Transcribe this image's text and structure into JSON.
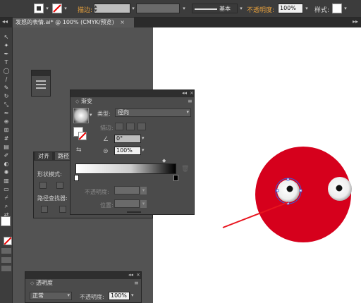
{
  "control_bar": {
    "stroke_label": "描边:",
    "stroke_profile": "基本",
    "opacity_label": "不透明度:",
    "opacity_value": "100%",
    "style_label": "样式:"
  },
  "document_tab": {
    "title": "发怒的表情.ai* @ 100% (CMYK/预览)",
    "close": "×"
  },
  "gradient_panel": {
    "tab_label": "渐变",
    "type_label": "类型:",
    "type_value": "径向",
    "stroke_label": "描边:",
    "angle_value": "0°",
    "aspect_value": "100%",
    "opacity_label": "不透明度:",
    "location_label": "位置:"
  },
  "align_panel": {
    "tab_align": "对齐",
    "tab_pathfinder": "路径",
    "shape_modes_label": "形状模式:",
    "pathfinder_label": "路径查找器:"
  },
  "transparency_panel": {
    "tab_label": "透明度",
    "blend_mode": "正常",
    "opacity_label": "不透明度:",
    "opacity_value": "100%"
  },
  "colors": {
    "face_red": "#d6001c",
    "ui_orange": "#e8a13c",
    "artboard": "#ffffff"
  }
}
